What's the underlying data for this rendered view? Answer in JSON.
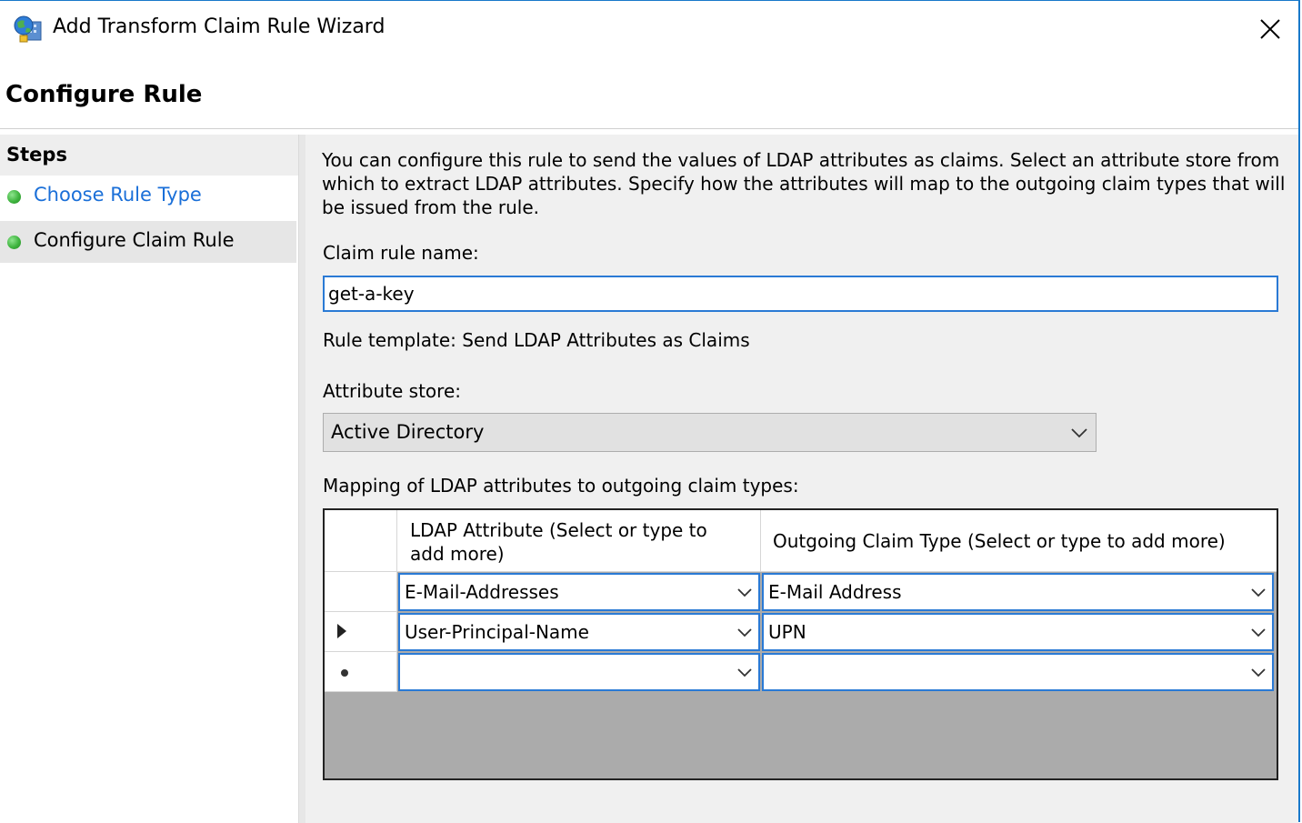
{
  "window": {
    "title": "Add Transform Claim Rule Wizard",
    "heading": "Configure Rule"
  },
  "steps": {
    "header": "Steps",
    "items": [
      {
        "label": "Choose Rule Type"
      },
      {
        "label": "Configure Claim Rule"
      }
    ]
  },
  "form": {
    "description": "You can configure this rule to send the values of LDAP attributes as claims. Select an attribute store from which to extract LDAP attributes. Specify how the attributes will map to the outgoing claim types that will be issued from the rule.",
    "claim_rule_name_label": "Claim rule name:",
    "claim_rule_name_value": "get-a-key",
    "rule_template": "Rule template: Send LDAP Attributes as Claims",
    "attribute_store_label": "Attribute store:",
    "attribute_store_value": "Active Directory",
    "mapping_label": "Mapping of LDAP attributes to outgoing claim types:"
  },
  "mapping_grid": {
    "columns": [
      "LDAP Attribute (Select or type to add more)",
      "Outgoing Claim Type (Select or type to add more)"
    ],
    "rows": [
      {
        "ldap": "E-Mail-Addresses",
        "claim": "E-Mail Address"
      },
      {
        "ldap": "User-Principal-Name",
        "claim": "UPN"
      },
      {
        "ldap": "",
        "claim": ""
      }
    ]
  },
  "colors": {
    "accent_blue": "#2a7ad5",
    "link_blue": "#1a6fd8",
    "step_done_green": "#3fb43f",
    "grid_empty_gray": "#ababab"
  },
  "icons": {
    "app": "wizard-app-icon",
    "close": "close-icon",
    "step_status": "green-dot-icon",
    "dropdown": "chevron-down-icon",
    "current_row": "current-row-arrow-icon",
    "new_row": "new-row-dot-icon"
  }
}
